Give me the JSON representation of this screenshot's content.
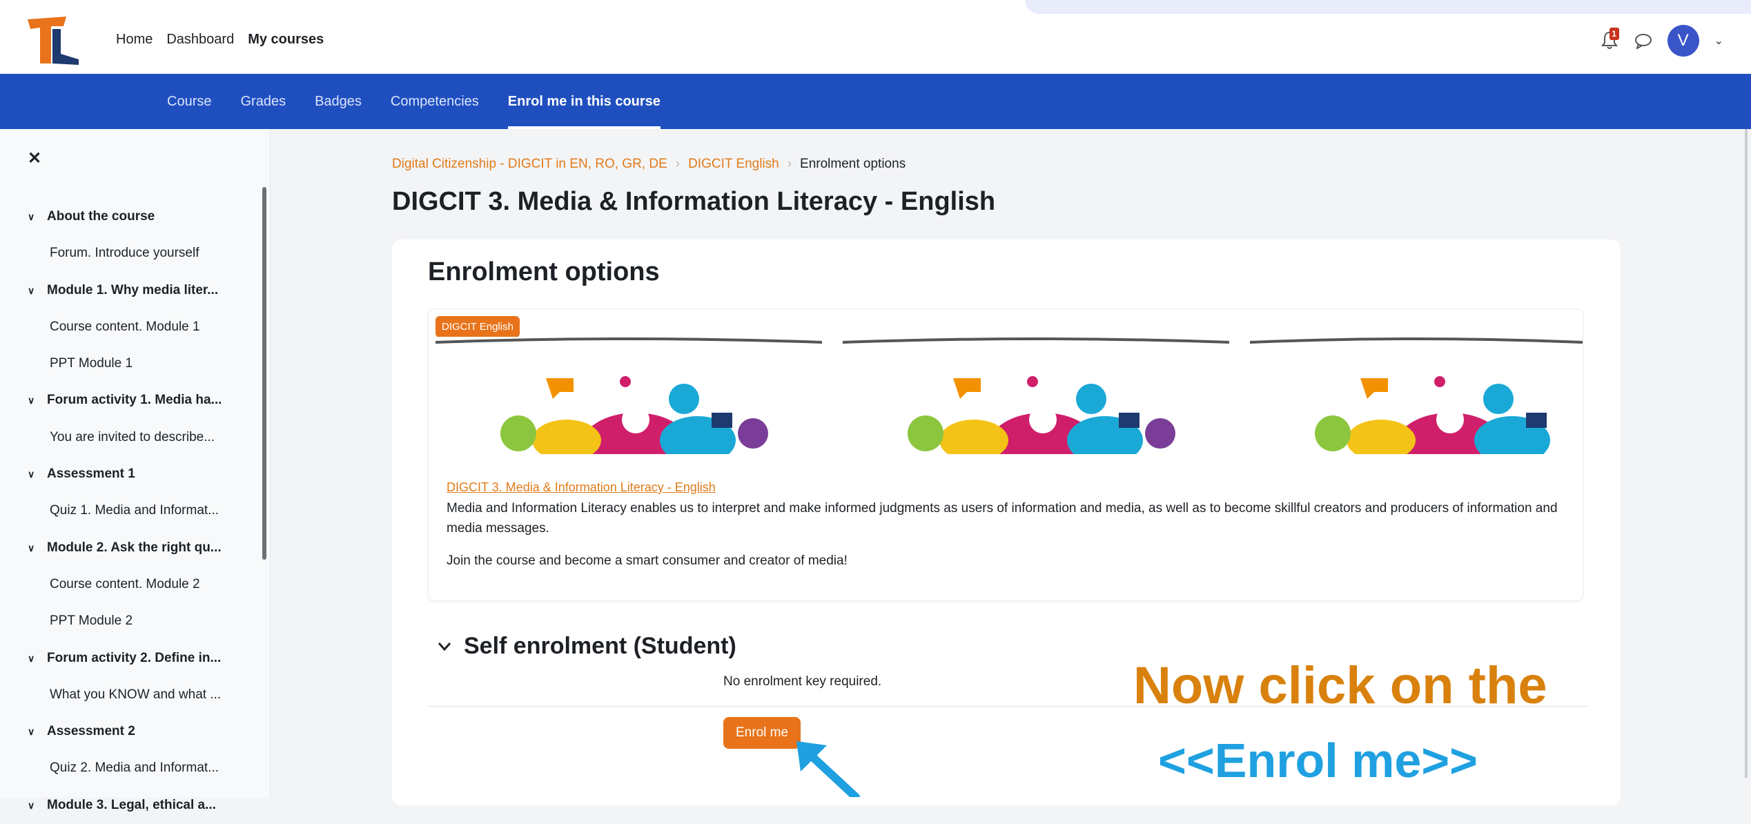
{
  "topnav": {
    "home": "Home",
    "dashboard": "Dashboard",
    "my_courses": "My courses"
  },
  "notifications": {
    "count": "1"
  },
  "user": {
    "initial": "V"
  },
  "secondary_nav": {
    "course": "Course",
    "grades": "Grades",
    "badges": "Badges",
    "competencies": "Competencies",
    "enrol": "Enrol me in this course"
  },
  "drawer": {
    "items": [
      {
        "type": "section",
        "label": "About the course"
      },
      {
        "type": "item",
        "label": "Forum. Introduce yourself"
      },
      {
        "type": "section",
        "label": "Module 1. Why media liter..."
      },
      {
        "type": "item",
        "label": "Course content. Module 1"
      },
      {
        "type": "item",
        "label": "PPT Module 1"
      },
      {
        "type": "section",
        "label": "Forum activity 1. Media ha..."
      },
      {
        "type": "item",
        "label": "You are invited to describe..."
      },
      {
        "type": "section",
        "label": "Assessment 1"
      },
      {
        "type": "item",
        "label": "Quiz 1. Media and Informat..."
      },
      {
        "type": "section",
        "label": "Module 2. Ask the right qu..."
      },
      {
        "type": "item",
        "label": "Course content. Module 2"
      },
      {
        "type": "item",
        "label": "PPT Module 2"
      },
      {
        "type": "section",
        "label": "Forum activity 2. Define in..."
      },
      {
        "type": "item",
        "label": "What you KNOW and what ..."
      },
      {
        "type": "section",
        "label": "Assessment 2"
      },
      {
        "type": "item",
        "label": "Quiz 2. Media and Informat..."
      },
      {
        "type": "section",
        "label": "Module 3. Legal, ethical a..."
      }
    ]
  },
  "breadcrumb": {
    "level1": "Digital Citizenship - DIGCIT in EN, RO, GR, DE",
    "level2": "DIGCIT English",
    "current": "Enrolment options"
  },
  "page_title": "DIGCIT 3. Media & Information Literacy - English",
  "enrolment": {
    "heading": "Enrolment options",
    "category_tag": "DIGCIT English",
    "course_link": "DIGCIT 3. Media & Information Literacy - English",
    "description": "Media and Information Literacy enables us to interpret and make informed judgments as users of information and media, as well as to become skillful creators and producers of information and media messages.",
    "description2": "Join the course and become a smart consumer and creator of media!",
    "self_heading": "Self enrolment (Student)",
    "no_key": "No enrolment key required.",
    "button": "Enrol me"
  },
  "overlay": {
    "line1": "Now click on the",
    "line2": "<<Enrol me>>"
  },
  "colors": {
    "brand_blue": "#1f4fbf",
    "accent_orange": "#e8731a",
    "overlay_orange": "#d9810d",
    "overlay_blue": "#1fa0e0"
  }
}
